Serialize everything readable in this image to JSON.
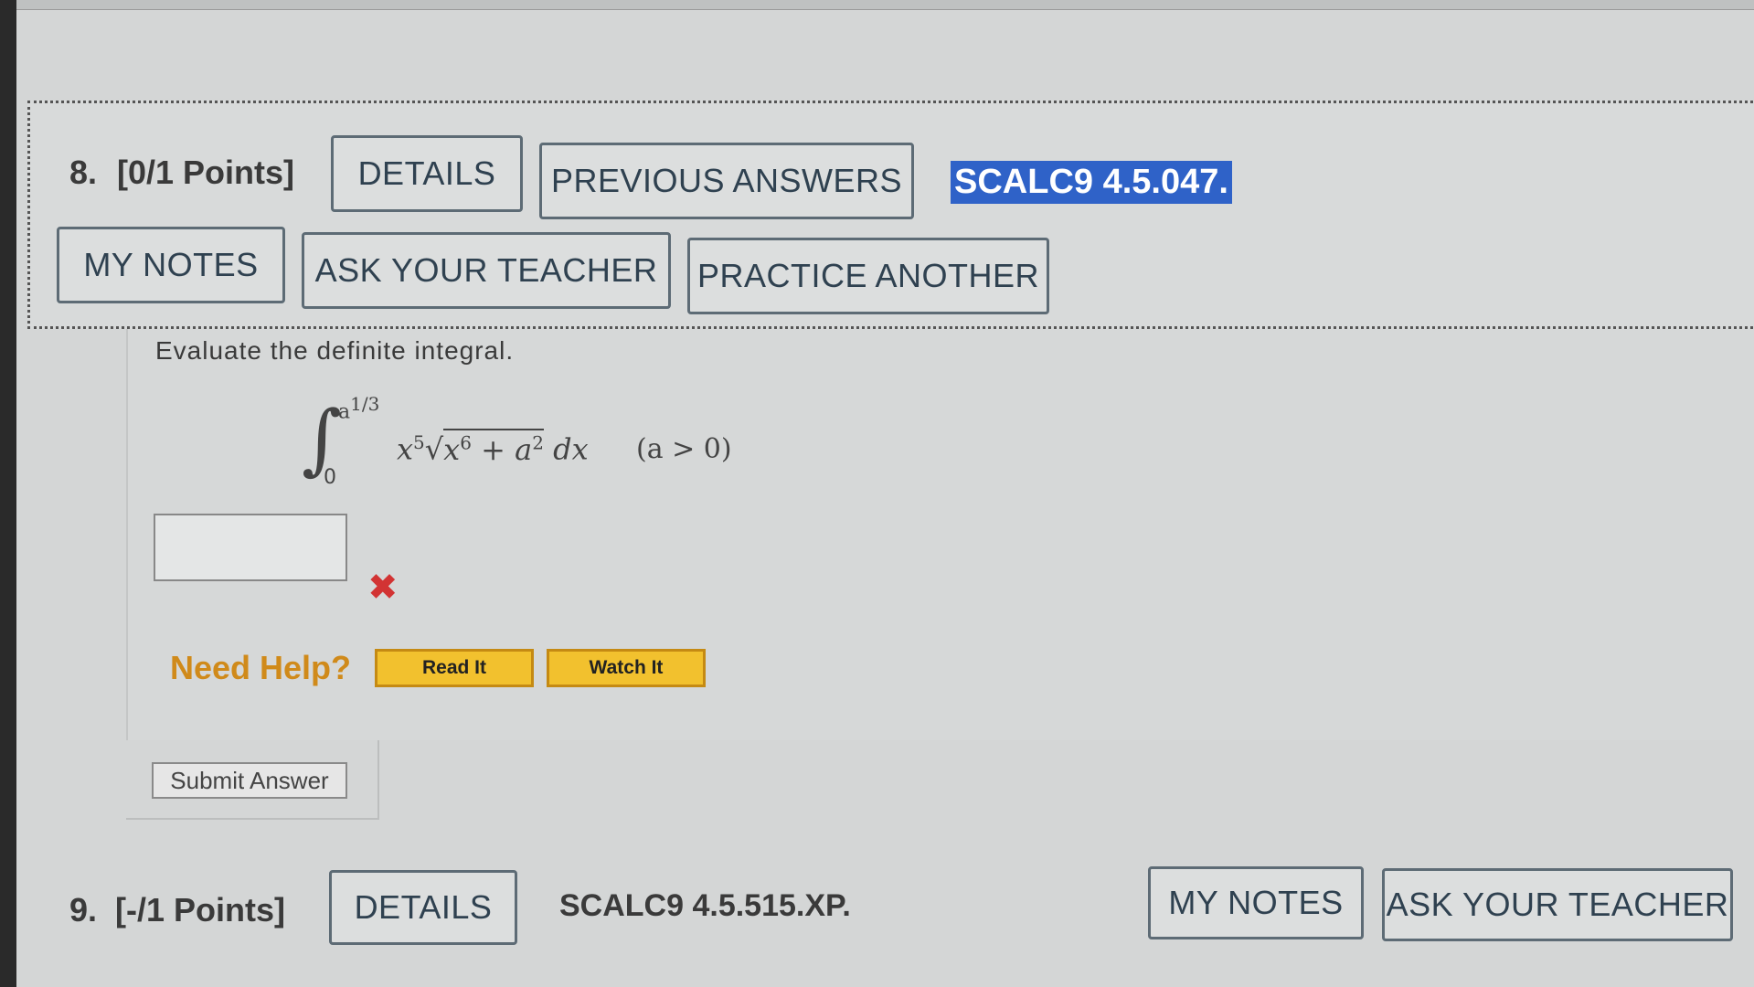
{
  "question8": {
    "number": "8.",
    "points": "[0/1 Points]",
    "buttons": {
      "details": "DETAILS",
      "previous_answers": "PREVIOUS ANSWERS",
      "my_notes": "MY NOTES",
      "ask_teacher": "ASK YOUR TEACHER",
      "practice_another": "PRACTICE ANOTHER"
    },
    "code": "SCALC9 4.5.047.",
    "prompt": "Evaluate the definite integral.",
    "integral": {
      "upper_base": "a",
      "upper_exp": "1/3",
      "lower": "0",
      "x": "x",
      "x_exp": "5",
      "inner_x": "x",
      "inner_exp": "6",
      "plus_a": " + a",
      "a_exp": "2",
      "dx": " dx",
      "condition": "(a > 0)"
    },
    "answer_value": "",
    "wrong_mark": "✖",
    "help": {
      "label": "Need Help?",
      "read_it": "Read It",
      "watch_it": "Watch It"
    },
    "submit": "Submit Answer"
  },
  "question9": {
    "number": "9.",
    "points": "[-/1 Points]",
    "details": "DETAILS",
    "code": "SCALC9 4.5.515.XP.",
    "my_notes": "MY NOTES",
    "ask_teacher": "ASK YOUR TEACHER"
  },
  "colors": {
    "accent_highlight": "#2f62c8",
    "help_button": "#f2c12e",
    "help_label": "#d08a1a",
    "wrong": "#d23333"
  }
}
